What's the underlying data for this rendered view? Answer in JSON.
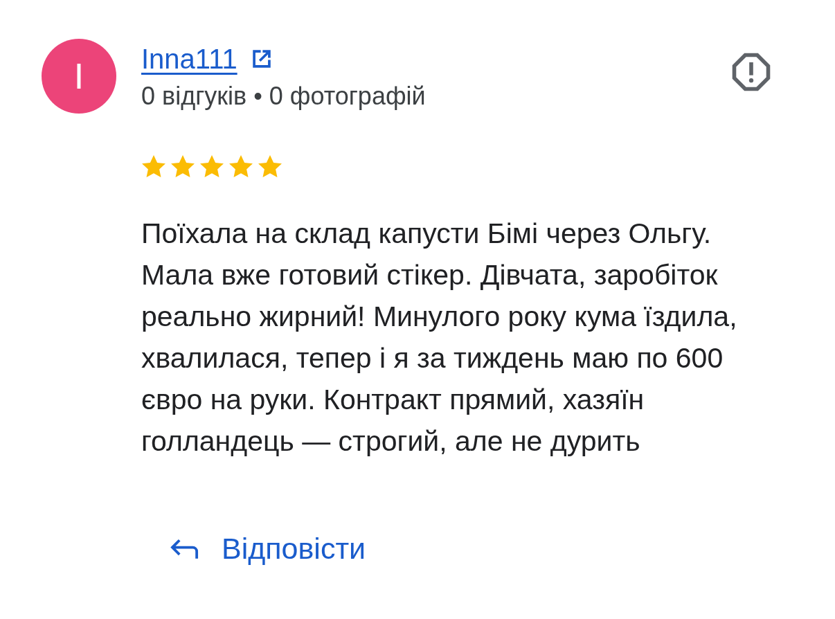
{
  "review": {
    "avatar_initial": "I",
    "name": "Inna111",
    "stats": "0 відгуків • 0 фотографій",
    "stars": 5,
    "text": "Поїхала на склад капусти Бімі через Ольгу. Мала вже готовий стікер. Дівчата, заробіток реально жирний! Минулого року кума їздила, хвалилася, тепер і я за тиждень маю по 600 євро на руки. Контракт прямий, хазяїн голландець — строгий, але не дурить"
  },
  "actions": [
    {
      "kind": "reply",
      "label": "Відповісти"
    }
  ]
}
